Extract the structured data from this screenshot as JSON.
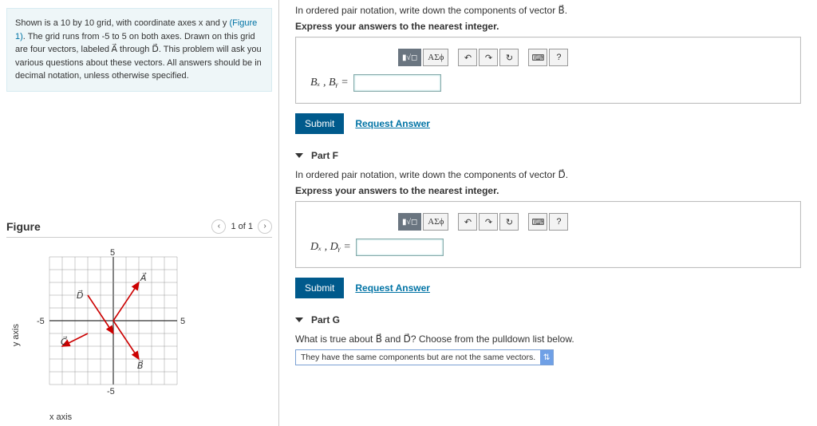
{
  "intro": {
    "line1": "Shown is a 10 by 10 grid, with coordinate axes x and y",
    "figure_link": "(Figure 1)",
    "line2": ". The grid runs from -5 to 5 on both axes. Drawn on this grid are four vectors, labeled A⃗ through D⃗. This problem will ask you various questions about these vectors. All answers should be in decimal notation, unless otherwise specified."
  },
  "figure": {
    "title": "Figure",
    "pager": "1 of 1",
    "y_axis_label": "y axis",
    "x_axis_label": "x axis",
    "tick_pos": "5",
    "tick_neg5a": "-5",
    "tick_neg5b": "-5",
    "vec_A": "A⃗",
    "vec_B": "B⃗",
    "vec_C": "C⃗",
    "vec_D": "D⃗"
  },
  "partE": {
    "question": "In ordered pair notation, write down the components of vector B⃗.",
    "instruction": "Express your answers to the nearest integer.",
    "var_label": "Bₓ , Bᵧ =",
    "toolbar": {
      "templates": "▮√◻",
      "greek": "ΑΣϕ",
      "undo": "↶",
      "redo": "↷",
      "reset": "↻",
      "keyboard": "⌨",
      "help": "?"
    },
    "submit": "Submit",
    "request": "Request Answer"
  },
  "partF": {
    "header": "Part F",
    "question": "In ordered pair notation, write down the components of vector D⃗.",
    "instruction": "Express your answers to the nearest integer.",
    "var_label": "Dₓ , Dᵧ =",
    "toolbar": {
      "templates": "▮√◻",
      "greek": "ΑΣϕ",
      "undo": "↶",
      "redo": "↷",
      "reset": "↻",
      "keyboard": "⌨",
      "help": "?"
    },
    "submit": "Submit",
    "request": "Request Answer"
  },
  "partG": {
    "header": "Part G",
    "question": "What is true about B⃗ and D⃗? Choose from the pulldown list below.",
    "selected": "They have the same components but are not the same vectors."
  },
  "chart_data": {
    "type": "vector-grid",
    "xlim": [
      -5,
      5
    ],
    "ylim": [
      -5,
      5
    ],
    "xlabel": "x axis",
    "ylabel": "y axis",
    "vectors": [
      {
        "name": "A",
        "from": [
          0,
          0
        ],
        "to": [
          2,
          3
        ]
      },
      {
        "name": "B",
        "from": [
          0,
          0
        ],
        "to": [
          2,
          -3
        ]
      },
      {
        "name": "C",
        "from": [
          -2,
          -1
        ],
        "to": [
          -4,
          -2
        ]
      },
      {
        "name": "D",
        "from": [
          -2,
          2
        ],
        "to": [
          0,
          -1
        ]
      }
    ]
  }
}
